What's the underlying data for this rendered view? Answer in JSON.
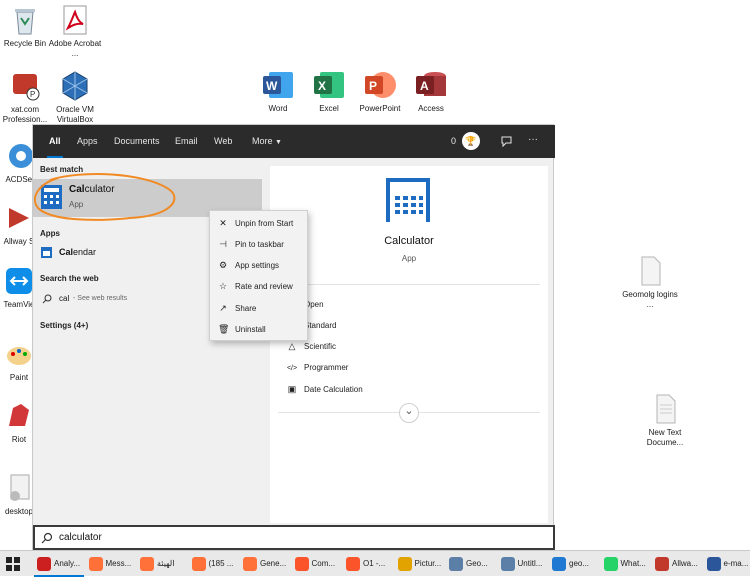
{
  "desktop": {
    "icons": [
      {
        "label": "Recycle Bin"
      },
      {
        "label": "Adobe Acrobat ..."
      },
      {
        "label": "xat.com Profession..."
      },
      {
        "label": "Oracle VM VirtualBox"
      },
      {
        "label": "ACDSee"
      },
      {
        "label": "Allway S"
      },
      {
        "label": "TeamVie"
      },
      {
        "label": "Paint"
      },
      {
        "label": "Riot"
      },
      {
        "label": "desktop"
      },
      {
        "label": "Geomolg logins ..."
      },
      {
        "label": "New Text Docume..."
      }
    ],
    "office": [
      {
        "label": "Word",
        "letter": "W",
        "color": "#2b579a"
      },
      {
        "label": "Excel",
        "letter": "X",
        "color": "#217346"
      },
      {
        "label": "PowerPoint",
        "letter": "P",
        "color": "#d24726"
      },
      {
        "label": "Access",
        "letter": "A",
        "color": "#a4373a"
      }
    ]
  },
  "search": {
    "tabs": [
      "All",
      "Apps",
      "Documents",
      "Email",
      "Web",
      "More"
    ],
    "more_arrow": "▼",
    "points": "0",
    "more_options": "···",
    "best_match_header": "Best match",
    "best_match_name_bold": "Cal",
    "best_match_name_rest": "culator",
    "best_match_type": "App",
    "apps_header": "Apps",
    "app_item_bold": "Cal",
    "app_item_rest": "endar",
    "web_header": "Search the web",
    "web_query": "cal",
    "web_hint": " - See web results",
    "settings_header": "Settings (4+)",
    "detail_name": "Calculator",
    "detail_type": "App",
    "detail_actions": [
      {
        "icon": "▭",
        "label": "Open"
      },
      {
        "icon": "▦",
        "label": "Standard"
      },
      {
        "icon": "△",
        "label": "Scientific"
      },
      {
        "icon": "</>",
        "label": "Programmer"
      },
      {
        "icon": "▣",
        "label": "Date Calculation"
      }
    ],
    "expand": "⌄",
    "query": "calculator"
  },
  "context_menu": [
    {
      "icon": "✕",
      "label": "Unpin from Start"
    },
    {
      "icon": "⊣",
      "label": "Pin to taskbar"
    },
    {
      "icon": "⚙",
      "label": "App settings"
    },
    {
      "icon": "☆",
      "label": "Rate and review"
    },
    {
      "icon": "↗",
      "label": "Share"
    },
    {
      "icon": "🗑",
      "label": "Uninstall"
    }
  ],
  "taskbar": [
    {
      "label": "Analy...",
      "color": "#cc1f1f"
    },
    {
      "label": "Mess...",
      "color": "#ff7139"
    },
    {
      "label": "الهيئة",
      "color": "#ff7139"
    },
    {
      "label": "(185 ...",
      "color": "#ff7139"
    },
    {
      "label": "Gene...",
      "color": "#ff7139"
    },
    {
      "label": "Com...",
      "color": "#fb542b"
    },
    {
      "label": "O1 -...",
      "color": "#fb542b"
    },
    {
      "label": "Pictur...",
      "color": "#e2a300"
    },
    {
      "label": "Geo...",
      "color": "#5c7fa8"
    },
    {
      "label": "Untitl...",
      "color": "#5c7fa8"
    },
    {
      "label": "geo...",
      "color": "#1f78d1"
    },
    {
      "label": "What...",
      "color": "#25d366"
    },
    {
      "label": "Allwa...",
      "color": "#c0392b"
    },
    {
      "label": "e-ma...",
      "color": "#2b579a"
    }
  ],
  "colors": {
    "accent": "#0078d4",
    "calc_blue": "#1d6cc1",
    "highlight_circle": "#f08a24"
  }
}
